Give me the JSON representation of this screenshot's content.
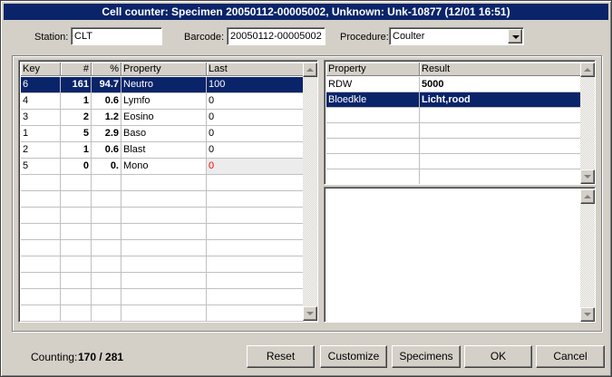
{
  "window": {
    "title": "Cell counter: Specimen 20050112-00005002, Unknown: Unk-10877 (12/01 16:51)"
  },
  "fields": {
    "station_label": "Station:",
    "station_value": "CLT",
    "barcode_label": "Barcode:",
    "barcode_value": "20050112-00005002",
    "procedure_label": "Procedure:",
    "procedure_value": "Coulter"
  },
  "counts_table": {
    "columns": [
      "Key",
      "#",
      "%",
      "Property",
      "Last"
    ],
    "rows": [
      {
        "key": "6",
        "count": "161",
        "pct": "94.7",
        "property": "Neutro",
        "last": "100"
      },
      {
        "key": "4",
        "count": "1",
        "pct": "0.6",
        "property": "Lymfo",
        "last": "0"
      },
      {
        "key": "3",
        "count": "2",
        "pct": "1.2",
        "property": "Eosino",
        "last": "0"
      },
      {
        "key": "1",
        "count": "5",
        "pct": "2.9",
        "property": "Baso",
        "last": "0"
      },
      {
        "key": "2",
        "count": "1",
        "pct": "0.6",
        "property": "Blast",
        "last": "0"
      },
      {
        "key": "5",
        "count": "0",
        "pct": "0.",
        "property": "Mono",
        "last": "0"
      }
    ],
    "selected_row": 0
  },
  "results_table": {
    "columns": [
      "Property",
      "Result"
    ],
    "rows": [
      {
        "property": "RDW",
        "result": "5000"
      },
      {
        "property": "Bloedkle",
        "result": "Licht,rood"
      }
    ],
    "selected_row": 1
  },
  "status": {
    "counting_label": "Counting:",
    "counting_value": "170 / 281"
  },
  "buttons": {
    "reset": "Reset",
    "customize": "Customize",
    "specimens": "Specimens",
    "ok": "OK",
    "cancel": "Cancel"
  },
  "colors": {
    "selection": "#0a246a",
    "titlebar": "#0a246a",
    "face": "#d4d0c8",
    "mono_last": "#ff0000"
  }
}
